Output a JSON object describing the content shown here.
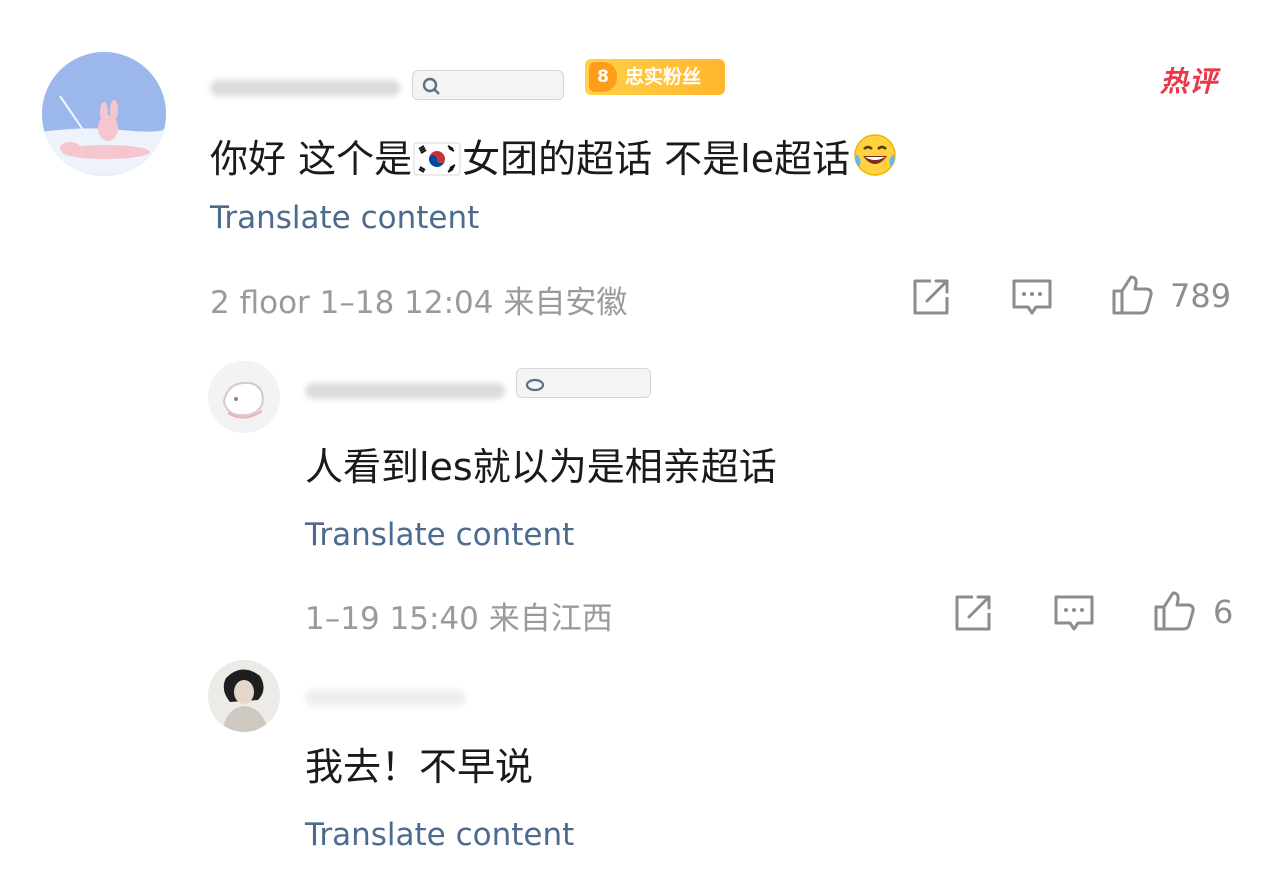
{
  "comments": [
    {
      "fan_badge": {
        "level": "8",
        "label": "忠实粉丝"
      },
      "hot_label": "热评",
      "content_before_flag": "你好 这个是",
      "content_after_flag": "女团的超话 不是le超话",
      "translate": "Translate content",
      "meta": "2 floor 1–18 12:04 来自安徽",
      "likes": "789"
    },
    {
      "content": "人看到les就以为是相亲超话",
      "translate": "Translate content",
      "meta": "1–19 15:40 来自江西",
      "likes": "6"
    },
    {
      "content": "我去！不早说",
      "translate": "Translate content"
    }
  ],
  "colors": {
    "link": "#4d6a8f",
    "meta": "#9a9a9a",
    "hot": "#e8384a",
    "badge": "#ffc23a"
  },
  "icons": [
    "forward-icon",
    "comment-icon",
    "like-icon",
    "korea-flag-icon",
    "laughing-emoji-icon"
  ]
}
